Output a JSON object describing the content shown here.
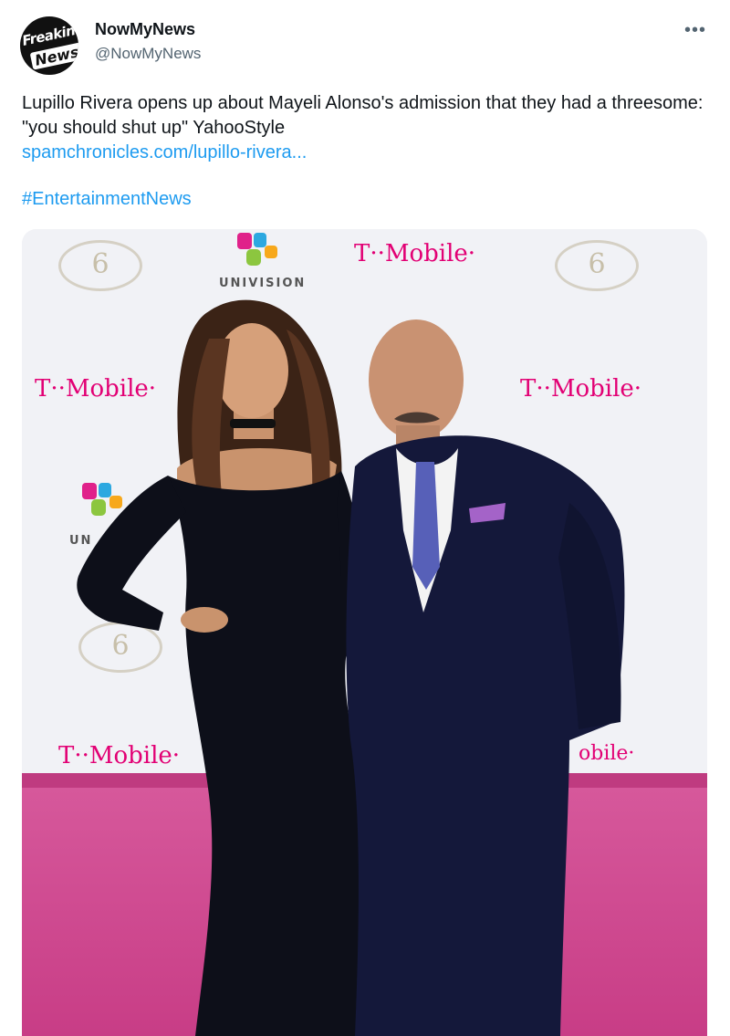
{
  "author": {
    "avatar_line1": "Freakin",
    "avatar_line2": "News",
    "name": "NowMyNews",
    "handle": "@NowMyNews"
  },
  "more_icon": "more-icon",
  "tweet": {
    "text": "Lupillo Rivera opens up about Mayeli Alonso's admission that they had a threesome: \"you should shut up\" YahooStyle",
    "link": "spamchronicles.com/lupillo-rivera...",
    "hashtag": "#EntertainmentNews"
  },
  "media": {
    "backdrop_brand_tmobile": "T··Mobile·",
    "backdrop_brand_tmobile_partial": "obile·",
    "backdrop_brand_univision": "UNIVISION",
    "backdrop_brand_univision_partial": "UN",
    "emblem_mark": "6"
  },
  "colors": {
    "link": "#1d9bf0",
    "tmobile_magenta": "#e20074",
    "carpet": "#d6589b",
    "dress": "#0d0f19",
    "suit": "#14183a"
  }
}
